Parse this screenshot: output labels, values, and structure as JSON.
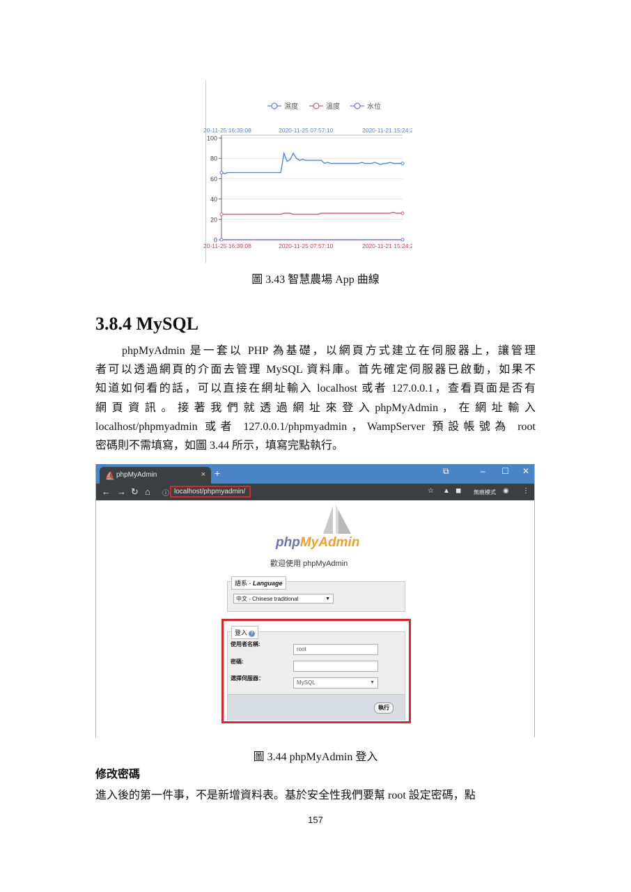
{
  "chart_data": {
    "type": "line",
    "legend": [
      "濕度",
      "溫度",
      "水位"
    ],
    "legend_position": "top",
    "x_ticks": [
      "20-11-25 16:39:08",
      "2020-11-25 07:57:10",
      "2020-11-21 15:24:2"
    ],
    "y_ticks": [
      "100",
      "80",
      "60",
      "40",
      "20",
      "0"
    ],
    "ylim": [
      0,
      100
    ],
    "grid": true,
    "series": [
      {
        "name": "濕度",
        "color": "#4f86e0",
        "values": [
          66,
          65,
          66,
          66,
          66,
          66,
          66,
          66,
          66,
          66,
          66,
          66,
          66,
          66,
          66,
          66,
          66,
          66,
          66,
          66,
          85,
          77,
          79,
          85,
          80,
          78,
          79,
          78,
          78,
          78,
          78,
          78,
          78,
          75,
          76,
          75,
          75,
          75,
          75,
          75,
          75,
          75,
          75,
          75,
          75,
          76,
          75,
          75,
          75,
          76,
          75,
          74,
          75,
          75,
          76,
          75,
          75,
          75,
          75
        ]
      },
      {
        "name": "溫度",
        "color": "#e05b6b",
        "values": [
          25,
          25,
          25,
          25,
          25,
          25,
          25,
          25,
          25,
          25,
          25,
          25,
          25,
          25,
          25,
          25,
          25,
          25,
          25,
          25,
          26,
          26,
          26,
          25,
          25,
          25,
          25,
          25,
          25,
          25,
          25,
          25,
          26,
          26,
          26,
          26,
          26,
          26,
          26,
          26,
          26,
          26,
          26,
          26,
          26,
          26,
          26,
          26,
          26,
          26,
          26,
          26,
          26,
          26,
          26,
          27,
          26,
          26,
          26
        ]
      },
      {
        "name": "水位",
        "color": "#7a6fe0",
        "values": [
          0,
          0,
          0,
          0,
          0,
          0,
          0,
          0,
          0,
          0,
          0,
          0,
          0,
          0,
          0,
          0,
          0,
          0,
          0,
          0,
          0,
          0,
          0,
          0,
          0,
          0,
          0,
          0,
          0,
          0,
          0,
          0,
          0,
          0,
          0,
          0,
          0,
          0,
          0,
          0,
          0,
          0,
          0,
          0,
          0,
          0,
          0,
          0,
          0,
          0,
          0,
          0,
          0,
          0,
          0,
          0,
          0,
          0,
          0
        ]
      }
    ]
  },
  "figure1_caption": "圖 3.43 智慧農場 App 曲線",
  "section_heading": "3.8.4 MySQL",
  "paragraph_lines": [
    "　　phpMyAdmin 是一套以 PHP 為基礎，以網頁方式建立在伺服器上，讓管理",
    "者可以透過網頁的介面去管理 MySQL 資料庫。首先確定伺服器已啟動，如果不",
    "知道如何看的話，可以直接在網址輸入 localhost 或者 127.0.0.1，查看頁面是否有",
    "網 頁 資 訊 。 接 著 我 們 就 透 過 網 址 來 登 入 phpMyAdmin ， 在 網 址 輸 入",
    "localhost/phpmyadmin 或者 127.0.0.1/phpmyadmin，WampServer 預設帳號為 root",
    "密碼則不需填寫，如圖 3.44 所示，填寫完點執行。"
  ],
  "browser": {
    "tab_title": "phpMyAdmin",
    "url": "localhost/phpmyadmin/",
    "incognito_label": "無痕模式",
    "pma": {
      "logo_php": "php",
      "logo_myadmin": "MyAdmin",
      "welcome": "歡迎使用 phpMyAdmin",
      "language_legend_zh": "語系 - ",
      "language_legend_en": "Language",
      "language_value": "中文 - Chinese traditional",
      "login_legend": "登入",
      "username_label": "使用者名稱:",
      "username_value": "root",
      "password_label": "密碼:",
      "password_value": "",
      "server_label": "選擇伺服器：",
      "server_value": "MySQL",
      "go_button": "執行"
    }
  },
  "figure2_caption": "圖 3.44 phpMyAdmin  登入",
  "subheading": "修改密碼",
  "paragraph2": "進入後的第一件事，不是新增資料表。基於安全性我們要幫 root 設定密碼，點",
  "page_number": "157"
}
